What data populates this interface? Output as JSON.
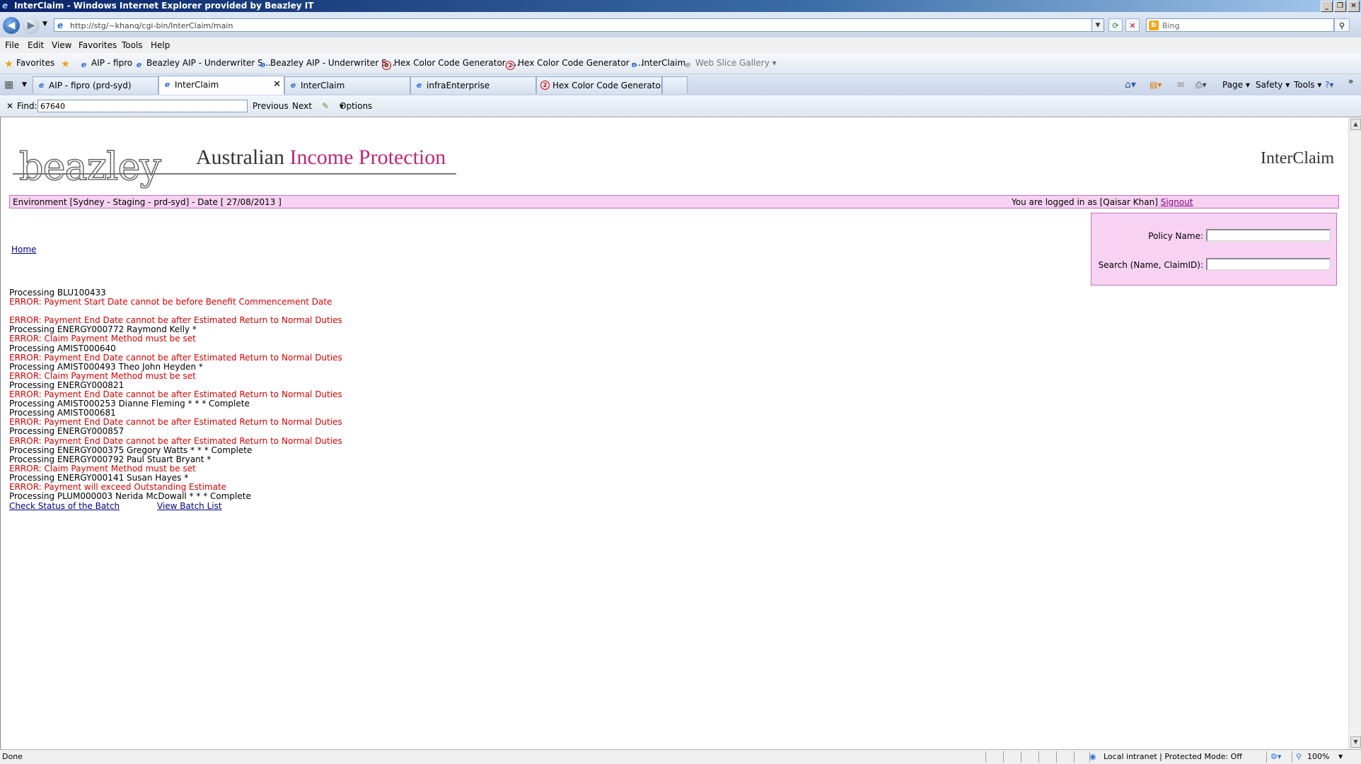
{
  "window": {
    "title": "InterClaim - Windows Internet Explorer provided by Beazley IT"
  },
  "address_bar": {
    "url": "http://stg/~khanq/cgi-bin/InterClaim/main",
    "search_placeholder": "Bing"
  },
  "menu": [
    "File",
    "Edit",
    "View",
    "Favorites",
    "Tools",
    "Help"
  ],
  "favorites_bar": {
    "label": "Favorites",
    "items": [
      "AIP - fipro",
      "Beazley AIP - Underwriter S...",
      "Beazley AIP - Underwriter S...",
      "Hex Color Code Generator -...",
      "Hex Color Code Generator -...",
      "InterClaim",
      "Web Slice Gallery"
    ]
  },
  "tabs": [
    {
      "label": "AIP - fipro (prd-syd)",
      "active": false
    },
    {
      "label": "InterClaim",
      "active": true
    },
    {
      "label": "InterClaim",
      "active": false
    },
    {
      "label": "infraEnterprise",
      "active": false
    },
    {
      "label": "Hex Color Code Generator - ...",
      "active": false
    }
  ],
  "command_bar": {
    "page": "Page",
    "safety": "Safety",
    "tools": "Tools"
  },
  "find_bar": {
    "label": "Find:",
    "value": "67640",
    "previous": "Previous",
    "next": "Next",
    "options": "Options"
  },
  "page": {
    "logo": "beazley",
    "logo_sub_plain": "Australian",
    "logo_sub_accent": "Income Protection",
    "brand": "InterClaim",
    "environment": "Environment [Sydney - Staging - prd-syd] - Date [ 27/08/2013 ]",
    "login_text": "You are logged in as [Qaisar Khan]",
    "signout": "Signout",
    "home_link": "Home",
    "search": {
      "policy_name_label": "Policy Name:",
      "search_label": "Search (Name, ClaimID):"
    },
    "log": [
      {
        "text": "Processing BLU100433",
        "type": "info"
      },
      {
        "text": "ERROR: Payment Start Date cannot be before Benefit Commencement Date",
        "type": "error"
      },
      {
        "text": "",
        "type": "info"
      },
      {
        "text": "ERROR: Payment End Date cannot be after Estimated Return to Normal Duties",
        "type": "error"
      },
      {
        "text": "Processing ENERGY000772 Raymond Kelly *",
        "type": "info"
      },
      {
        "text": "ERROR: Claim Payment Method must be set",
        "type": "error"
      },
      {
        "text": "Processing AMIST000640",
        "type": "info"
      },
      {
        "text": "ERROR: Payment End Date cannot be after Estimated Return to Normal Duties",
        "type": "error"
      },
      {
        "text": "Processing AMIST000493 Theo John Heyden *",
        "type": "info"
      },
      {
        "text": "ERROR: Claim Payment Method must be set",
        "type": "error"
      },
      {
        "text": "Processing ENERGY000821",
        "type": "info"
      },
      {
        "text": "ERROR: Payment End Date cannot be after Estimated Return to Normal Duties",
        "type": "error"
      },
      {
        "text": "Processing AMIST000253 Dianne Fleming * * * Complete",
        "type": "info"
      },
      {
        "text": "Processing AMIST000681",
        "type": "info"
      },
      {
        "text": "ERROR: Payment End Date cannot be after Estimated Return to Normal Duties",
        "type": "error"
      },
      {
        "text": "Processing ENERGY000857",
        "type": "info"
      },
      {
        "text": "ERROR: Payment End Date cannot be after Estimated Return to Normal Duties",
        "type": "error"
      },
      {
        "text": "Processing ENERGY000375 Gregory Watts * * * Complete",
        "type": "info"
      },
      {
        "text": "Processing ENERGY000792 Paul Stuart Bryant *",
        "type": "info"
      },
      {
        "text": "ERROR: Claim Payment Method must be set",
        "type": "error"
      },
      {
        "text": "Processing ENERGY000141 Susan Hayes *",
        "type": "info"
      },
      {
        "text": "ERROR: Payment will exceed Outstanding Estimate",
        "type": "error"
      },
      {
        "text": "Processing PLUM000003 Nerida McDowall * * * Complete",
        "type": "info"
      }
    ],
    "check_status_link": "Check Status of the Batch",
    "view_batch_link": "View Batch List"
  },
  "status_bar": {
    "status": "Done",
    "zone": "Local intranet | Protected Mode: Off",
    "zoom": "100%"
  },
  "colors": {
    "env_bar_bg": "#f7d2f2",
    "error_text": "#e00000",
    "brand_accent": "#c2257b"
  }
}
